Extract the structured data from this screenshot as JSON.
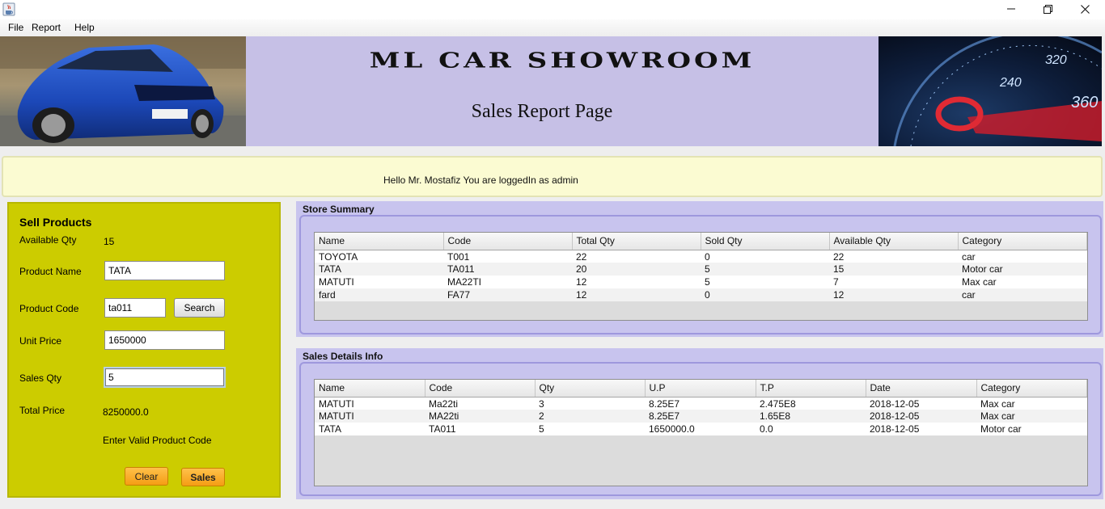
{
  "window": {
    "title": ""
  },
  "menu": {
    "items": [
      "File",
      "Report",
      "Help"
    ]
  },
  "banner": {
    "title": "ML CAR SHOWROOM",
    "subtitle": "Sales Report Page"
  },
  "welcome": {
    "text": "Hello Mr. Mostafiz You are loggedIn as admin"
  },
  "sell": {
    "heading": "Sell  Products",
    "available_qty_label": "Available Qty",
    "available_qty_value": "15",
    "product_name_label": "Product Name",
    "product_name_value": "TATA",
    "product_code_label": "Product Code",
    "product_code_value": "ta011",
    "search_label": "Search",
    "unit_price_label": "Unit Price",
    "unit_price_value": "1650000",
    "sales_qty_label": "Sales Qty",
    "sales_qty_value": "5",
    "total_price_label": "Total Price",
    "total_price_value": "8250000.0",
    "message": "Enter Valid Product Code",
    "clear_label": "Clear",
    "sales_label": "Sales"
  },
  "store_summary": {
    "title": "Store Summary",
    "columns": [
      "Name",
      "Code",
      "Total Qty",
      "Sold Qty",
      "Available Qty",
      "Category"
    ],
    "rows": [
      [
        "TOYOTA",
        "T001",
        "22",
        "0",
        "22",
        "car"
      ],
      [
        "TATA",
        "TA011",
        "20",
        "5",
        "15",
        "Motor car"
      ],
      [
        "MATUTI",
        "MA22TI",
        "12",
        "5",
        "7",
        "Max car"
      ],
      [
        "fard",
        "FA77",
        "12",
        "0",
        "12",
        "car"
      ]
    ]
  },
  "sales_details": {
    "title": "Sales Details Info",
    "columns": [
      "Name",
      "Code",
      "Qty",
      "U.P",
      "T.P",
      "Date",
      "Category"
    ],
    "rows": [
      [
        "MATUTI",
        "Ma22ti",
        "3",
        "8.25E7",
        "2.475E8",
        "2018-12-05",
        "Max car"
      ],
      [
        "MATUTI",
        "MA22ti",
        "2",
        "8.25E7",
        "1.65E8",
        "2018-12-05",
        "Max car"
      ],
      [
        "TATA",
        "TA011",
        "5",
        "1650000.0",
        "0.0",
        "2018-12-05",
        "Motor car"
      ]
    ]
  },
  "colors": {
    "banner_bg": "#c6c0e6",
    "sell_panel_bg": "#cccc00",
    "welcome_bg": "#fbfbd2",
    "group_bg": "#c8c4ee",
    "orange_button": "#f7a51b"
  },
  "icons": {
    "app": "java-cup-icon",
    "minimize": "minimize-icon",
    "maximize": "restore-icon",
    "close": "close-icon"
  }
}
